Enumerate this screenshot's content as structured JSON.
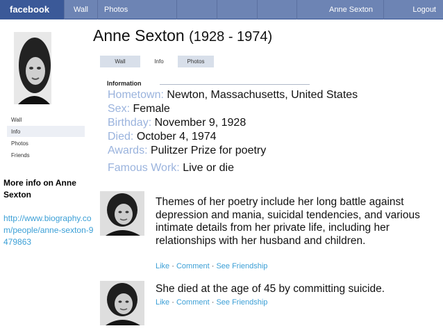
{
  "topbar": {
    "logo": "facebook",
    "wall": "Wall",
    "photos": "Photos",
    "user": "Anne Sexton",
    "logout": "Logout"
  },
  "profile": {
    "name": "Anne Sexton",
    "years": "(1928 - 1974)"
  },
  "tabs": [
    "Wall",
    "Info",
    "Photos"
  ],
  "leftnav": [
    "Wall",
    "Info",
    "Photos",
    "Friends"
  ],
  "more_info": {
    "heading": "More info on Anne Sexton",
    "link": "http://www.biography.com/people/anne-sexton-9479863"
  },
  "information": {
    "heading": "Information",
    "rows": [
      {
        "label": "Hometown:",
        "value": "Newton, Massachusetts, United States"
      },
      {
        "label": "Sex:",
        "value": "Female"
      },
      {
        "label": "Birthday:",
        "value": "November 9, 1928"
      },
      {
        "label": "Died:",
        "value": "October 4, 1974"
      },
      {
        "label": "Awards:",
        "value": "Pulitzer Prize for poetry"
      },
      {
        "label": "Famous Work:",
        "value": "Live or die"
      }
    ]
  },
  "posts": [
    {
      "text": "Themes of her poetry include her long battle against depression and mania, suicidal tendencies, and various intimate details from her private life, including her relationships with her husband and children.",
      "actions": [
        "Like",
        "Comment",
        "See Friendship"
      ]
    },
    {
      "text": "She died at the age of 45 by committing suicide.",
      "actions": [
        "Like",
        "Comment",
        "See Friendship"
      ]
    }
  ],
  "colors": {
    "topbar": "#6d84b4",
    "logo_bg": "#3b5998",
    "label_blue": "#9ab3dd",
    "link_blue": "#3b9fd6",
    "tab_bg": "#d8dfea"
  },
  "icons": {
    "profile_photo": "portrait-photo-icon",
    "post_photo": "portrait-thumbnail-icon"
  }
}
